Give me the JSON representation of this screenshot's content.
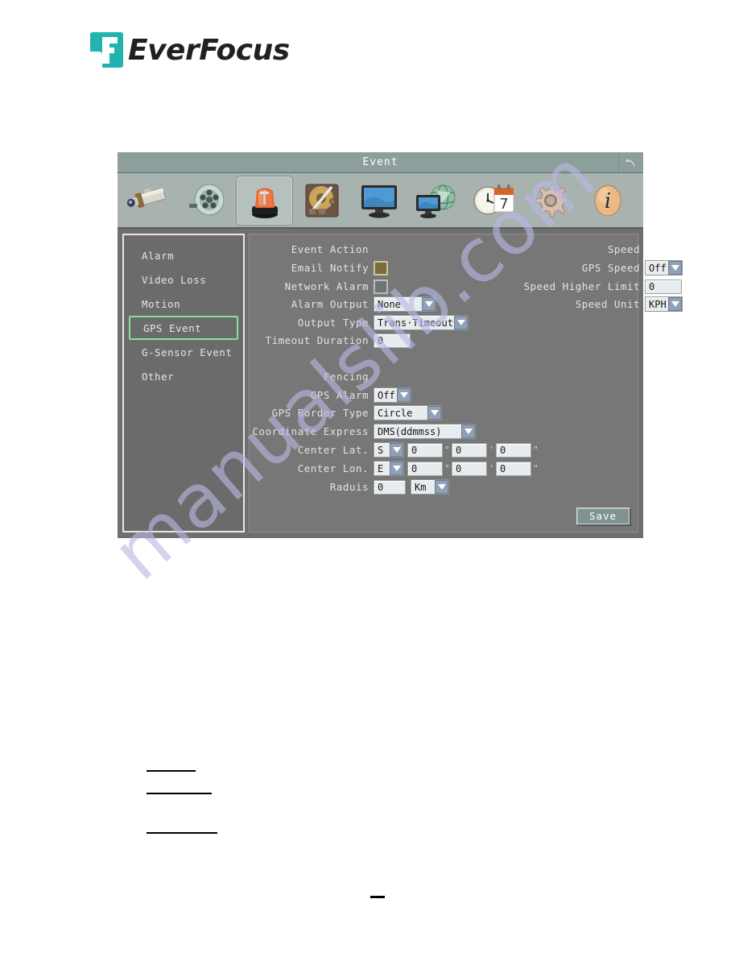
{
  "brand": {
    "name": "EverFocus"
  },
  "panel": {
    "title": "Event",
    "back_icon": "back-arrow-icon",
    "toolbar_icons": [
      {
        "name": "camera-icon",
        "label": "Camera"
      },
      {
        "name": "film-reel-icon",
        "label": "Record"
      },
      {
        "name": "alarm-light-icon",
        "label": "Event",
        "selected": true
      },
      {
        "name": "hard-disk-icon",
        "label": "Disk"
      },
      {
        "name": "monitor-icon",
        "label": "Display"
      },
      {
        "name": "network-globe-icon",
        "label": "Network"
      },
      {
        "name": "clock-calendar-icon",
        "label": "Date/Time"
      },
      {
        "name": "gear-icon",
        "label": "System"
      },
      {
        "name": "info-icon",
        "label": "Information"
      }
    ],
    "sidebar": {
      "items": [
        {
          "label": "Alarm",
          "selected": false
        },
        {
          "label": "Video Loss",
          "selected": false
        },
        {
          "label": "Motion",
          "selected": false
        },
        {
          "label": "GPS Event",
          "selected": true
        },
        {
          "label": "G-Sensor Event",
          "selected": false
        },
        {
          "label": "Other",
          "selected": false
        }
      ],
      "selected_color": "#84e29a"
    },
    "form": {
      "event_action_head": "Event Action",
      "speed_head": "Speed",
      "fencing_head": "Fencing",
      "email_notify_label": "Email Notify",
      "email_notify_state": "on",
      "network_alarm_label": "Network Alarm",
      "network_alarm_state": "off",
      "alarm_output_label": "Alarm Output",
      "alarm_output_value": "None",
      "output_type_label": "Output Type",
      "output_type_value": "Trans·Timeout",
      "timeout_duration_label": "Timeout Duration",
      "timeout_duration_value": "0",
      "gps_speed_label": "GPS Speed",
      "gps_speed_value": "Off",
      "speed_higher_limit_label": "Speed Higher Limit",
      "speed_higher_limit_value": "0",
      "speed_unit_label": "Speed Unit",
      "speed_unit_value": "KPH",
      "gps_alarm_label": "GPS Alarm",
      "gps_alarm_value": "Off",
      "gps_border_type_label": "GPS Border Type",
      "gps_border_type_value": "Circle",
      "coordinate_express_label": "Coordinate Express",
      "coordinate_express_value": "DMS(ddmmss)",
      "center_lat_label": "Center Lat.",
      "center_lat_hemisphere": "S",
      "center_lat_deg": "0",
      "center_lat_min": "0",
      "center_lat_sec": "0",
      "center_lon_label": "Center Lon.",
      "center_lon_hemisphere": "E",
      "center_lon_deg": "0",
      "center_lon_min": "0",
      "center_lon_sec": "0",
      "radius_label": "Raduis",
      "radius_value": "0",
      "radius_unit": "Km",
      "deg_symbol": "°",
      "min_symbol": "'",
      "sec_symbol": "\"",
      "save_label": "Save"
    }
  },
  "watermark": {
    "text": "manualslib.com",
    "color": "#b9b9e4"
  }
}
